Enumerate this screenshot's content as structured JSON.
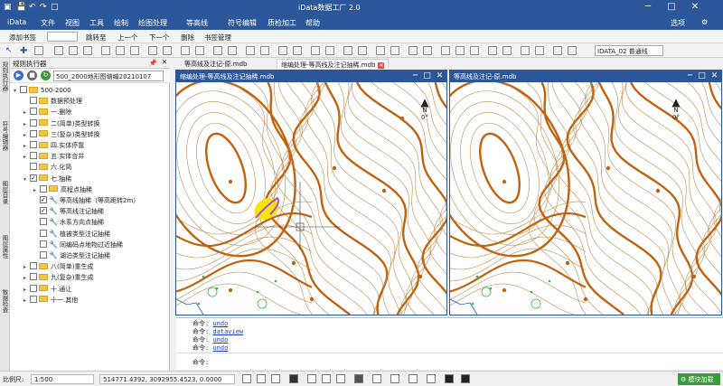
{
  "window": {
    "title": "iData数据工厂 2.0",
    "logged_in": "选项"
  },
  "menu": {
    "items": [
      "iData",
      "文件",
      "视图",
      "工具",
      "绘制",
      "绘图处理",
      "等高线",
      "符号编辑",
      "质检加工",
      "帮助"
    ]
  },
  "bookmarks": {
    "add": "添加书签",
    "jump": "跳转至",
    "prev": "上一个",
    "next": "下一个",
    "delete": "删除",
    "manage": "书签管理"
  },
  "layer": {
    "value": "IDATA_02 普通线"
  },
  "side_tabs": [
    "规则执行器",
    "符号编辑器",
    "图层目录",
    "图层属性",
    "数据检查"
  ],
  "panel": {
    "title": "规则执行器",
    "rule_file": "500_2000地形图缩编20210107",
    "tree": [
      {
        "level": 0,
        "expand": "▾",
        "check": false,
        "type": "folder",
        "label": "500-2000"
      },
      {
        "level": 1,
        "expand": "",
        "check": false,
        "type": "folder",
        "label": "数据预处理"
      },
      {
        "level": 1,
        "expand": "▸",
        "check": false,
        "type": "folder",
        "label": "一.删除"
      },
      {
        "level": 1,
        "expand": "▸",
        "check": false,
        "type": "folder",
        "label": "二(简单)类型转换"
      },
      {
        "level": 1,
        "expand": "▸",
        "check": false,
        "type": "folder",
        "label": "三(复杂)类型转换"
      },
      {
        "level": 1,
        "expand": "▸",
        "check": false,
        "type": "folder",
        "label": "四.实体停靠"
      },
      {
        "level": 1,
        "expand": "▸",
        "check": false,
        "type": "folder",
        "label": "五.实体合并"
      },
      {
        "level": 1,
        "expand": "",
        "check": false,
        "type": "folder",
        "label": "六.化简"
      },
      {
        "level": 1,
        "expand": "▾",
        "check": true,
        "type": "folder",
        "label": "七.抽稀"
      },
      {
        "level": 2,
        "expand": "▸",
        "check": false,
        "type": "folder",
        "label": "高程点抽稀"
      },
      {
        "level": 2,
        "expand": "",
        "check": true,
        "type": "tool",
        "label": "等高线抽稀（等高距转2m）"
      },
      {
        "level": 2,
        "expand": "",
        "check": true,
        "type": "tool",
        "label": "等高线注记抽稀"
      },
      {
        "level": 2,
        "expand": "",
        "check": false,
        "type": "tool",
        "label": "水系方向点抽稀"
      },
      {
        "level": 2,
        "expand": "",
        "check": false,
        "type": "tool",
        "label": "植被类型注记抽稀"
      },
      {
        "level": 2,
        "expand": "",
        "check": false,
        "type": "tool",
        "label": "同编码点地物过近抽稀"
      },
      {
        "level": 2,
        "expand": "",
        "check": false,
        "type": "tool",
        "label": "湖泊类型注记抽稀"
      },
      {
        "level": 1,
        "expand": "▸",
        "check": false,
        "type": "folder",
        "label": "八(简单)重生成"
      },
      {
        "level": 1,
        "expand": "▸",
        "check": false,
        "type": "folder",
        "label": "九(复杂)重生成"
      },
      {
        "level": 1,
        "expand": "▸",
        "check": false,
        "type": "folder",
        "label": "十.通让"
      },
      {
        "level": 1,
        "expand": "▸",
        "check": false,
        "type": "folder",
        "label": "十一.其他"
      }
    ]
  },
  "doc_tabs": [
    {
      "label": "等高线及注记-原.mdb",
      "active": false
    },
    {
      "label": "缩编处理-等高线及注记抽稀.mdb",
      "active": true
    }
  ],
  "map_left": {
    "title": "缩编处理-等高线及注记抽稀.mdb",
    "north": "N",
    "angle": "0°"
  },
  "map_right": {
    "title": "等高线及注记-原.mdb",
    "north": "N",
    "angle": "0°"
  },
  "command": {
    "lines": [
      {
        "prefix": "命令:",
        "value": "undo",
        "link": true
      },
      {
        "prefix": "命令:",
        "value": "dataview",
        "link": true
      },
      {
        "prefix": "命令:",
        "value": "undo",
        "link": true
      },
      {
        "prefix": "命令:",
        "value": "undo",
        "link": true
      }
    ],
    "prompt": "命令:"
  },
  "status": {
    "scale_label": "比例尺:",
    "scale_value": "1:500",
    "coords": "514771.4392, 3092955.4523, 0.0000",
    "module": "模块加载"
  },
  "colors": {
    "accent": "#2b579a",
    "contour_index": "#c0620e",
    "contour": "#b88a4a",
    "highlight": "#f2e60a",
    "selection": "#b54bd6"
  }
}
